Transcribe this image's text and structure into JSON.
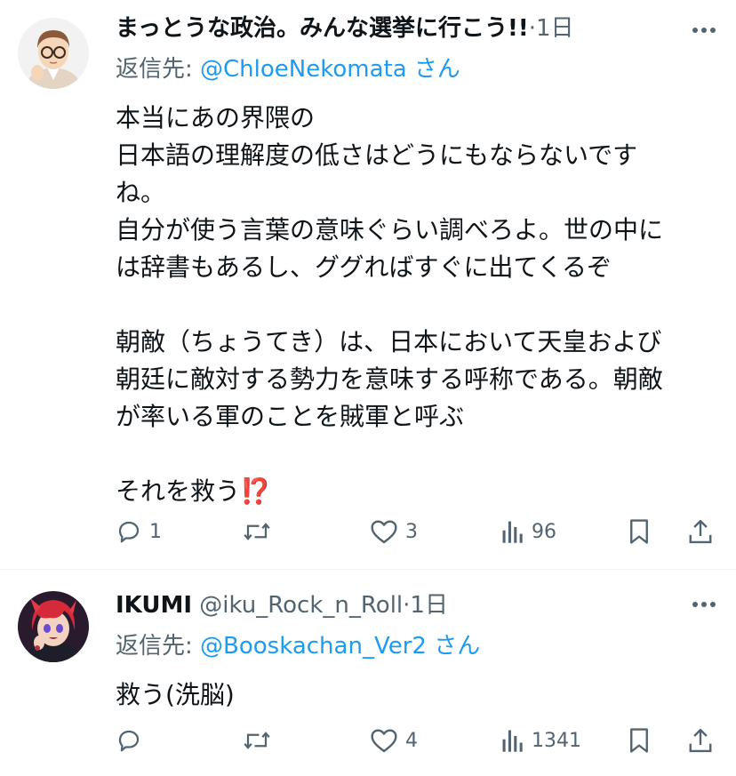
{
  "tweets": [
    {
      "display_name": "まっとうな政治。みんな選挙に行こう!!",
      "handle": "",
      "separator": "·",
      "time": "1日",
      "reply_prefix": "返信先: ",
      "reply_mention": "@ChloeNekomata",
      "reply_suffix": " さん",
      "lines": [
        "本当にあの界隈の",
        "日本語の理解度の低さはどうにもならないです",
        "ね。",
        "自分が使う言葉の意味ぐらい調べろよ。世の中に",
        "は辞書もあるし、ググればすぐに出てくるぞ",
        "",
        "朝敵（ちょうてき）は、日本において天皇および",
        "朝廷に敵対する勢力を意味する呼称である。朝敵",
        "が率いる軍のことを賊軍と呼ぶ",
        "",
        "それを救う"
      ],
      "emoji": "⁉️",
      "reply_count": "1",
      "retweet_count": "",
      "like_count": "3",
      "view_count": "96"
    },
    {
      "display_name": "IKUMI",
      "handle": "@iku_Rock_n_Roll",
      "separator": "·",
      "time": "1日",
      "reply_prefix": "返信先: ",
      "reply_mention": "@Booskachan_Ver2",
      "reply_suffix": " さん",
      "lines": [
        "救う(洗脳)"
      ],
      "reply_count": "",
      "retweet_count": "",
      "like_count": "4",
      "view_count": "1341"
    }
  ],
  "colors": {
    "text": "#0f1419",
    "secondary": "#536471",
    "link": "#1d9bf0",
    "divider": "#eff3f4"
  },
  "icons": [
    "more-icon",
    "reply-icon",
    "retweet-icon",
    "like-icon",
    "views-icon",
    "bookmark-icon",
    "share-icon"
  ]
}
